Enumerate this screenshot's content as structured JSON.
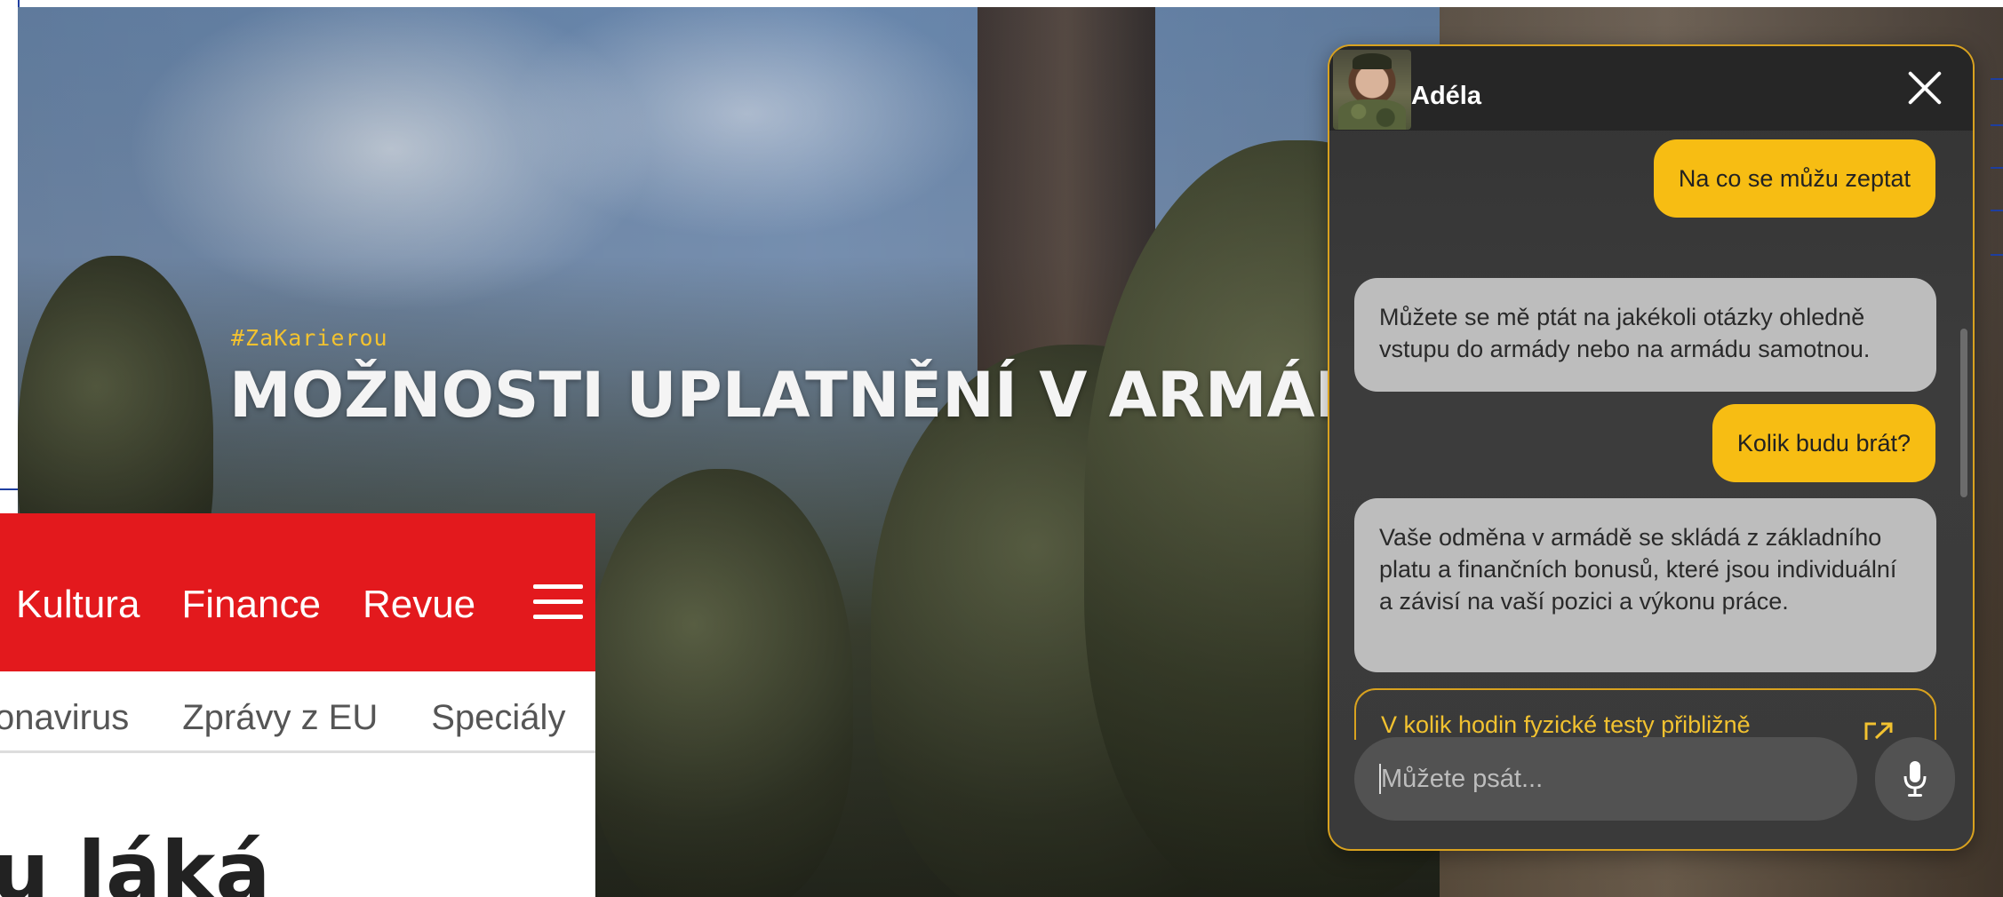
{
  "hero": {
    "tag": "#ZaKarierou",
    "title": "MOŽNOSTI UPLATNĚNÍ V ARMÁDĚ"
  },
  "news_site": {
    "nav": [
      "Kultura",
      "Finance",
      "Revue"
    ],
    "subnav": [
      "onavirus",
      "Zprávy z EU",
      "Speciály"
    ],
    "headline": "u láká",
    "accent_color": "#e3191d"
  },
  "chat": {
    "agent_name": "Adéla",
    "accent_color": "#f7bd13",
    "messages": [
      {
        "role": "user",
        "text": "Na co se můžu zeptat"
      },
      {
        "role": "bot",
        "text": "Můžete se mě ptát na jakékoli otázky ohledně vstupu do armády nebo na armádu samotnou."
      },
      {
        "role": "user",
        "text": "Kolik budu brát?"
      },
      {
        "role": "bot",
        "text": "Vaše odměna v armádě se skládá z základního platu a finančních bonusů, které jsou individuální a závisí na vaší pozici a výkonu práce."
      }
    ],
    "suggestion": "V kolik hodin fyzické testy přibližně",
    "input_placeholder": "Můžete psát...",
    "icons": {
      "close": "close-icon",
      "expand": "external-link-icon",
      "mic": "microphone-icon"
    }
  }
}
